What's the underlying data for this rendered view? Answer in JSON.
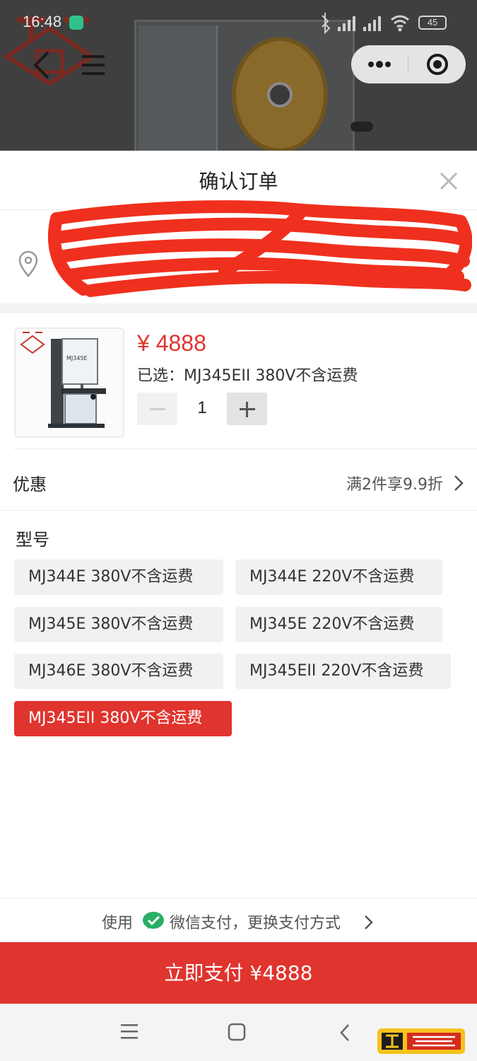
{
  "status_bar": {
    "time": "16:48",
    "battery": "45"
  },
  "sheet": {
    "title": "确认订单",
    "address": {
      "line1": "",
      "line2": ""
    },
    "product": {
      "price": "¥ 4888",
      "selected_prefix": "已选：",
      "selected_value": "MJ345EII 380V不含运费",
      "quantity": "1",
      "image_caption": "MJ345E"
    },
    "promo": {
      "label": "优惠",
      "value": "满2件享9.9折"
    },
    "model": {
      "title": "型号",
      "options": [
        "MJ344E 380V不含运费",
        "MJ344E 220V不含运费",
        "MJ345E 380V不含运费",
        "MJ345E 220V不含运费",
        "MJ346E 380V不含运费",
        "MJ345EII 220V不含运费",
        "MJ345EII 380V不含运费"
      ],
      "selected_index": 6
    },
    "payment": {
      "use_label": "使用",
      "rest_label": "微信支付，更换支付方式"
    },
    "pay_button": "立即支付 ¥4888"
  },
  "colors": {
    "accent": "#e0342e",
    "wechat_green": "#2aae67",
    "chip_bg": "#f1f1f1"
  },
  "icons": {
    "location": "location-pin-icon",
    "close": "close-icon",
    "back": "chevron-left-icon",
    "menu": "hamburger-menu-icon",
    "more": "more-dots-icon",
    "target": "target-icon",
    "promo_arrow": "chevron-right-icon",
    "wechat": "wechat-pay-icon"
  }
}
